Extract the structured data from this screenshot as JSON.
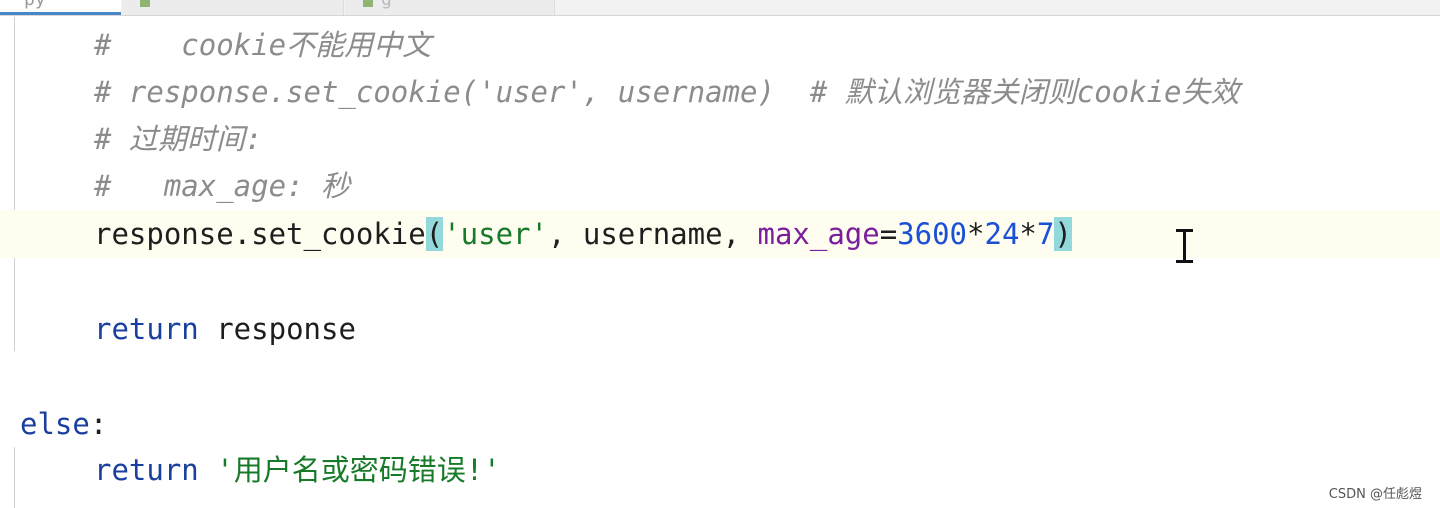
{
  "tabs": [
    {
      "label": "py",
      "active": true
    },
    {
      "label": "",
      "active": false
    },
    {
      "label": "g",
      "active": false
    }
  ],
  "code": {
    "l1": {
      "hash": "#",
      "text": "    cookie不能用中文"
    },
    "l2": {
      "text": "# response.set_cookie('user', username)  # 默认浏览器关闭则cookie失效"
    },
    "l3": {
      "text": "# 过期时间:"
    },
    "l4": {
      "hash": "#",
      "text": "   max_age: 秒"
    },
    "l5": {
      "obj": "response.set_cookie",
      "lparen": "(",
      "arg1": "'user'",
      "sep1": ", username, ",
      "kwarg": "max_age",
      "eq": "=",
      "n1": "3600",
      "op1": "*",
      "n2": "24",
      "op2": "*",
      "n3": "7",
      "rparen": ")"
    },
    "l6": {
      "keyword": "return",
      "value": " response"
    },
    "l7": {
      "keyword": "else",
      "colon": ":"
    },
    "l8": {
      "keyword": "return",
      "value": "'用户名或密码错误!'"
    }
  },
  "colors": {
    "keyword": "#1a3f9e",
    "string": "#177a28",
    "comment": "#8c8c8c",
    "param": "#7a1e9e",
    "number": "#1a4fd6",
    "brace_match": "#93d9db"
  },
  "cursor_icon": "text-cursor-icon",
  "watermark": "CSDN @任彪煜"
}
